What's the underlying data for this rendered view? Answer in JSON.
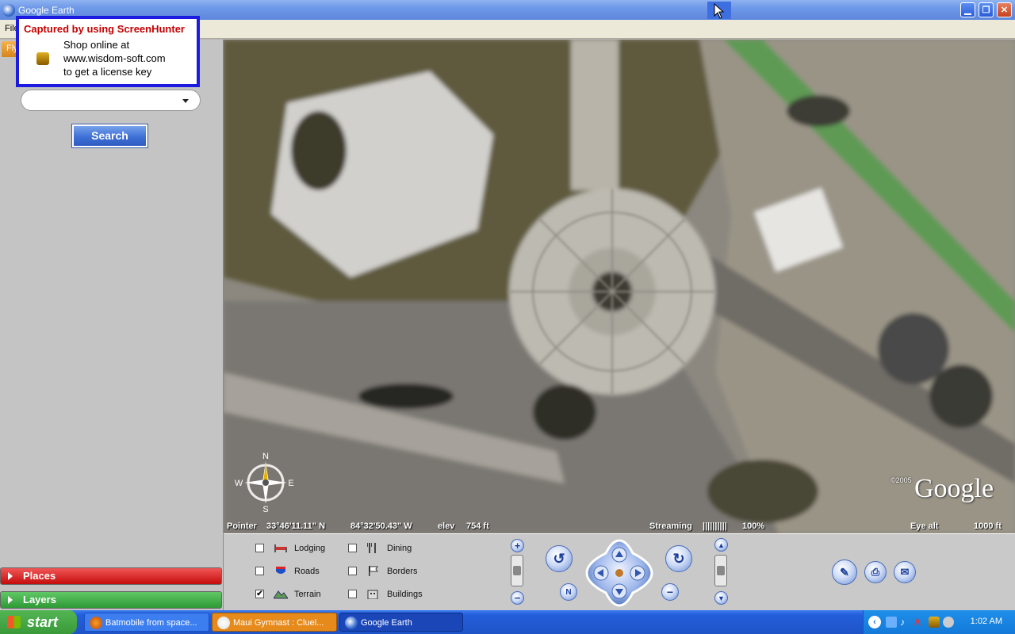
{
  "window": {
    "title": "Google Earth",
    "min_label": "▁",
    "max_label": "❐",
    "close_label": "✕"
  },
  "menu": {
    "first_item": "File"
  },
  "sidebar": {
    "fly_tab": "Fly",
    "search_value": "",
    "search_button": "Search",
    "places_label": "Places",
    "layers_label": "Layers"
  },
  "watermark": {
    "title": "Captured by using ScreenHunter",
    "line1": "Shop online at",
    "line2": "www.wisdom-soft.com",
    "line3": "to get a license key"
  },
  "map": {
    "pointer_label": "Pointer",
    "lat": "33°46'11.11\"  N",
    "lon": "84°32'50.43\"  W",
    "elev_label": "elev",
    "elev_value": "754 ft",
    "streaming_label": "Streaming",
    "streaming_bar": "||||||||||",
    "streaming_pct": "100%",
    "eye_label": "Eye  alt",
    "eye_value": "1000 ft",
    "copyright": "©2005",
    "logo": "Google",
    "compass_n": "N",
    "compass_s": "S",
    "compass_e": "E",
    "compass_w": "W"
  },
  "layers": [
    {
      "label": "Lodging",
      "checked": false,
      "icon": "bed-icon"
    },
    {
      "label": "Dining",
      "checked": false,
      "icon": "fork-knife-icon"
    },
    {
      "label": "Roads",
      "checked": false,
      "icon": "interstate-shield-icon"
    },
    {
      "label": "Borders",
      "checked": false,
      "icon": "flag-icon"
    },
    {
      "label": "Terrain",
      "checked": true,
      "icon": "mountain-icon"
    },
    {
      "label": "Buildings",
      "checked": false,
      "icon": "building-icon"
    }
  ],
  "taskbar": {
    "start": "start",
    "tasks": [
      {
        "label": "Batmobile from space...",
        "icon": "firefox-icon"
      },
      {
        "label": "Maui Gymnast : Cluel...",
        "icon": "firefox-icon"
      },
      {
        "label": "Google Earth",
        "icon": "google-earth-icon"
      }
    ],
    "clock": "1:02 AM"
  },
  "colors": {
    "places": "#d81a1a",
    "layers": "#3aa53f",
    "active_task": "#1a46b8",
    "orange_task": "#e68a1c"
  }
}
